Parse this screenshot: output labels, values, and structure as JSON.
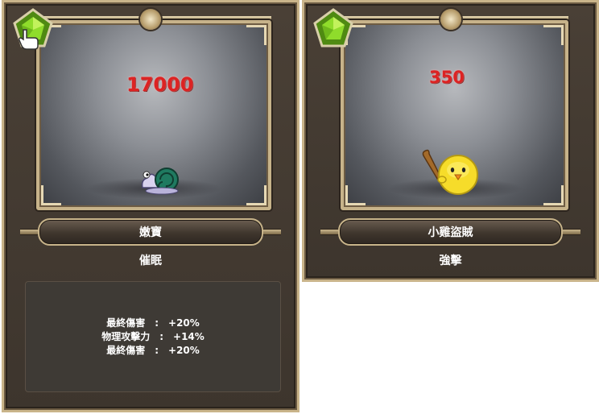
{
  "cards": [
    {
      "damage": "17000",
      "monster_name": "嫩寶",
      "skill_name": "催眠",
      "stats": [
        {
          "label": "最終傷害",
          "sep": ":",
          "value": "+20%"
        },
        {
          "label": "物理攻擊力",
          "sep": ":",
          "value": "+14%"
        },
        {
          "label": "最終傷害",
          "sep": ":",
          "value": "+20%"
        }
      ]
    },
    {
      "damage": "350",
      "monster_name": "小雞盜賊",
      "skill_name": "強擊"
    }
  ],
  "colors": {
    "damage": "#dc2323",
    "frame_border": "#c9b48a",
    "card_bg": "#3d352d",
    "gem": "#7ed321"
  },
  "icons": [
    "green-pentagon-gem-icon",
    "hand-cursor-icon",
    "snail-monster-icon",
    "chick-bandit-monster-icon"
  ]
}
